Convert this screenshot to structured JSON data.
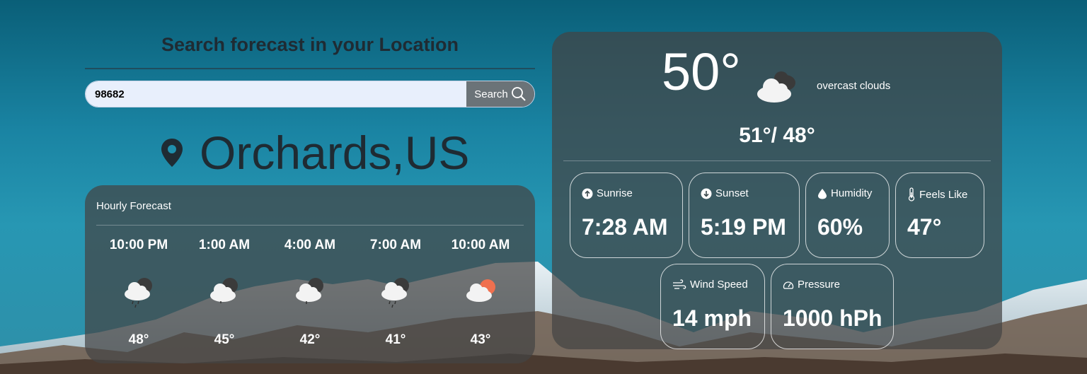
{
  "search": {
    "title": "Search forecast in your Location",
    "input_value": "98682",
    "button_label": "Search"
  },
  "location": {
    "name": "Orchards,US"
  },
  "hourly": {
    "title": "Hourly Forecast",
    "items": [
      {
        "time": "10:00 PM",
        "temp": "48°",
        "icon": "rainy-cloud-night-icon"
      },
      {
        "time": "1:00 AM",
        "temp": "45°",
        "icon": "cloudy-night-icon"
      },
      {
        "time": "4:00 AM",
        "temp": "42°",
        "icon": "rainy-cloud-night-icon"
      },
      {
        "time": "7:00 AM",
        "temp": "41°",
        "icon": "rainy-cloud-night-icon"
      },
      {
        "time": "10:00 AM",
        "temp": "43°",
        "icon": "cloud-sun-icon"
      }
    ]
  },
  "current": {
    "temp": "50°",
    "icon": "overcast-clouds-icon",
    "description": "overcast clouds",
    "hi_lo": "51°/ 48°"
  },
  "stats": {
    "sunrise": {
      "label": "Sunrise",
      "value": "7:28 AM",
      "icon": "arrow-up-circle-icon"
    },
    "sunset": {
      "label": "Sunset",
      "value": "5:19 PM",
      "icon": "arrow-down-circle-icon"
    },
    "humidity": {
      "label": "Humidity",
      "value": "60%",
      "icon": "droplet-icon"
    },
    "feels_like": {
      "label": "Feels Like",
      "value": "47°",
      "icon": "thermometer-icon"
    },
    "wind_speed": {
      "label": "Wind Speed",
      "value": "14 mph",
      "icon": "wind-icon"
    },
    "pressure": {
      "label": "Pressure",
      "value": "1000 hPh",
      "icon": "gauge-icon"
    }
  }
}
